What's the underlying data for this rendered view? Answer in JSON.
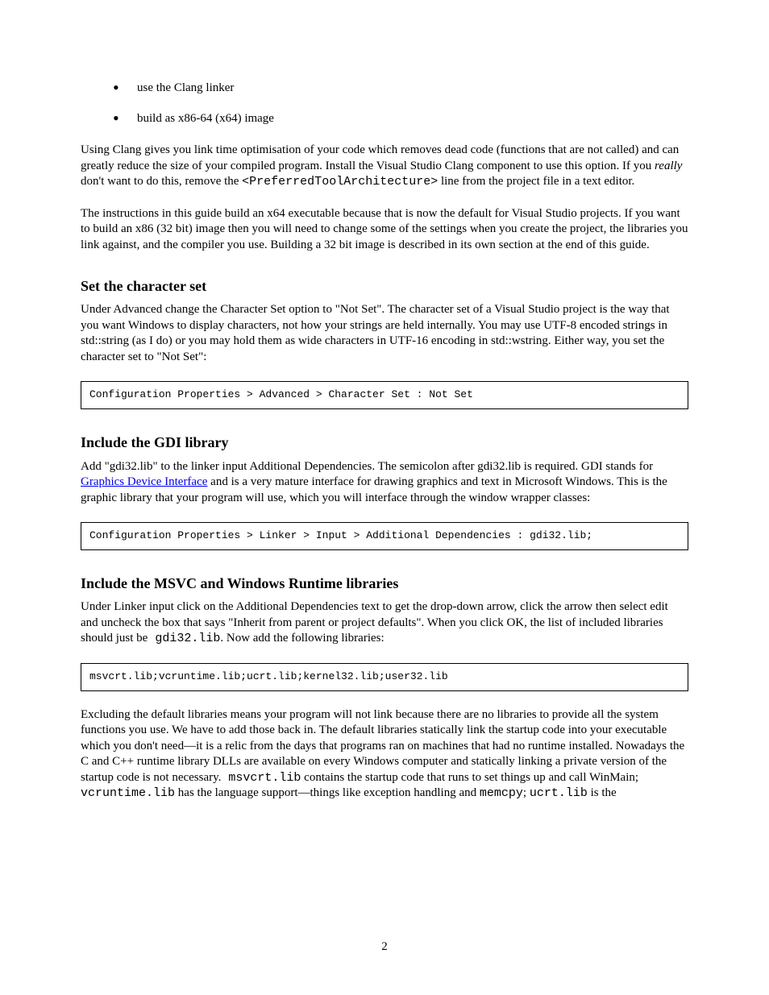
{
  "bullets": [
    "use the Clang linker",
    "build as x86-64 (x64) image"
  ],
  "intro_para_part1": "Using Clang gives you link time optimisation of your code which removes dead code (functions that are not called) and can greatly reduce the size of your compiled program. Install the Visual Studio Clang component to use this option. If you ",
  "intro_para_italic": "really",
  "intro_para_part2": " don't want to do this, remove the ",
  "intro_para_mono": "<PreferredToolArchitecture>",
  "intro_para_part3": " line from the project file in a text editor.",
  "para2": "The instructions in this guide build an x64 executable because that is now the default for Visual Studio projects. If you want to build an x86 (32 bit) image then you will need to change some of the settings when you create the project, the libraries you link against, and the compiler you use. Building a 32 bit image is described in its own section at the end of this guide.",
  "section1": {
    "title": "Set the character set",
    "text": "Under Advanced change the Character Set option to \"Not Set\". The character set of a Visual Studio project is the way that you want Windows to display characters, not how your strings are held internally. You may use UTF-8 encoded strings in std::string (as I do) or you may hold them as wide characters in UTF-16 encoding in std::wstring. Either way, you set the character set to \"Not Set\":",
    "code": "Configuration Properties > Advanced > Character Set : Not Set"
  },
  "section2": {
    "title": "Include the GDI library",
    "text_part1": "Add \"gdi32.lib\" to the linker input Additional Dependencies. The semicolon after gdi32.lib is required. GDI stands for ",
    "link_text": "Graphics Device Interface",
    "text_part2": " and is a very mature interface for drawing graphics and text in Microsoft Windows. This is the graphic library that your program will use, which you will interface through the window wrapper classes:",
    "code": "Configuration Properties > Linker > Input > Additional Dependencies : gdi32.lib;"
  },
  "section3": {
    "title": "Include the MSVC and Windows Runtime libraries",
    "text1_part1": "Under Linker input click on the Additional Dependencies text to get the drop-down arrow, click the arrow then select edit and uncheck the box that says \"Inherit from parent or project defaults\". When you click OK, the list of included libraries should just be",
    "text1_mono": " gdi32.lib",
    "text1_part2": ". Now add the following libraries:",
    "code": "msvcrt.lib;vcruntime.lib;ucrt.lib;kernel32.lib;user32.lib",
    "text2_part1": "Excluding the default libraries means your program will not link because there are no libraries to provide all the system functions you use. We have to add those back in. The default libraries statically link the startup code into your executable which you don't need—it is a relic from the days that programs ran on machines that had no runtime installed. Nowadays the C and C++ runtime library DLLs are available on every Windows computer and statically linking a private version of the startup code is not necessary.",
    "text2_mono1": " msvcrt.lib",
    "text2_part2": " contains the startup code that runs to set things up and call WinMain; ",
    "text2_mono2": "vcruntime.lib",
    "text2_part3": " has the language support—things like exception handling and ",
    "text2_mono3": "memcpy",
    "text2_part4": "; ",
    "text2_mono4": "ucrt.lib",
    "text2_part5": " is the"
  },
  "page_number": "2"
}
